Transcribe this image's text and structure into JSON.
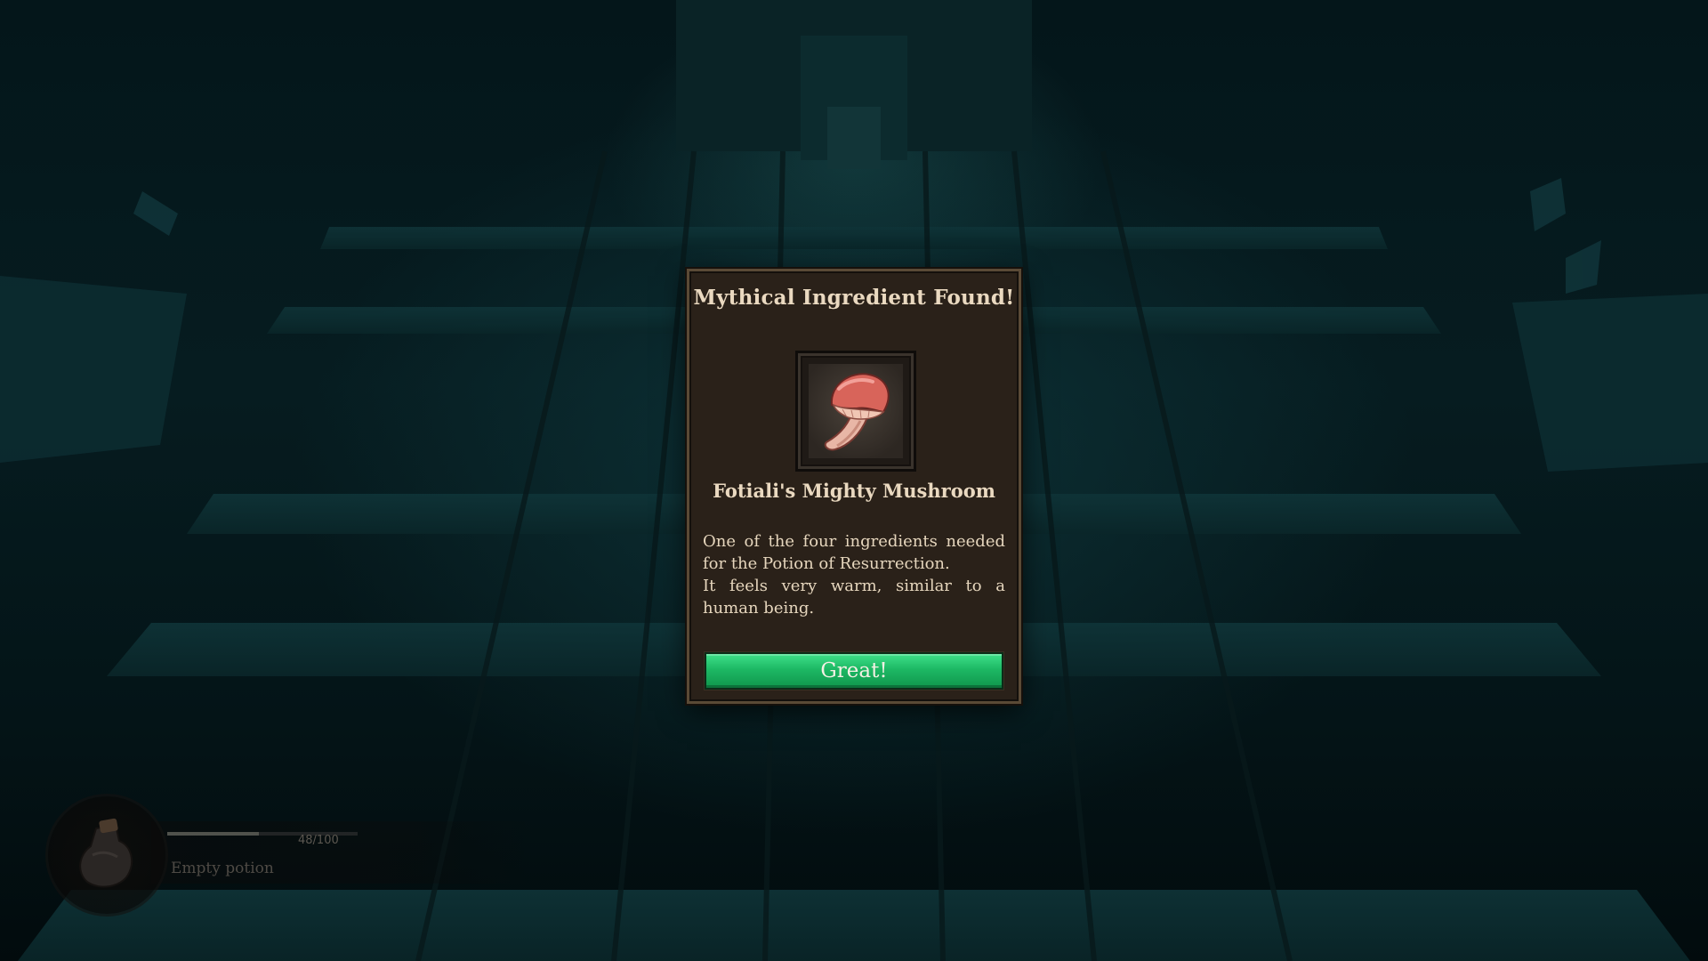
{
  "dialog": {
    "title": "Mythical Ingredient Found!",
    "item_name": "Fotiali's Mighty Mushroom",
    "item_icon": "mushroom-icon",
    "description": [
      "One of the four ingredients needed for the Potion of Resurrection.",
      "It feels very warm, similar to a human being."
    ],
    "confirm_label": "Great!"
  },
  "hud": {
    "potion": {
      "icon": "potion-flask-icon",
      "count": "48/100",
      "fill_fraction": 0.48,
      "label": "Empty potion"
    }
  },
  "colors": {
    "dialog_bg": "#2a2119",
    "dialog_border": "#5a4a36",
    "button_green": "#1db864",
    "text_cream": "#ead9c0"
  }
}
